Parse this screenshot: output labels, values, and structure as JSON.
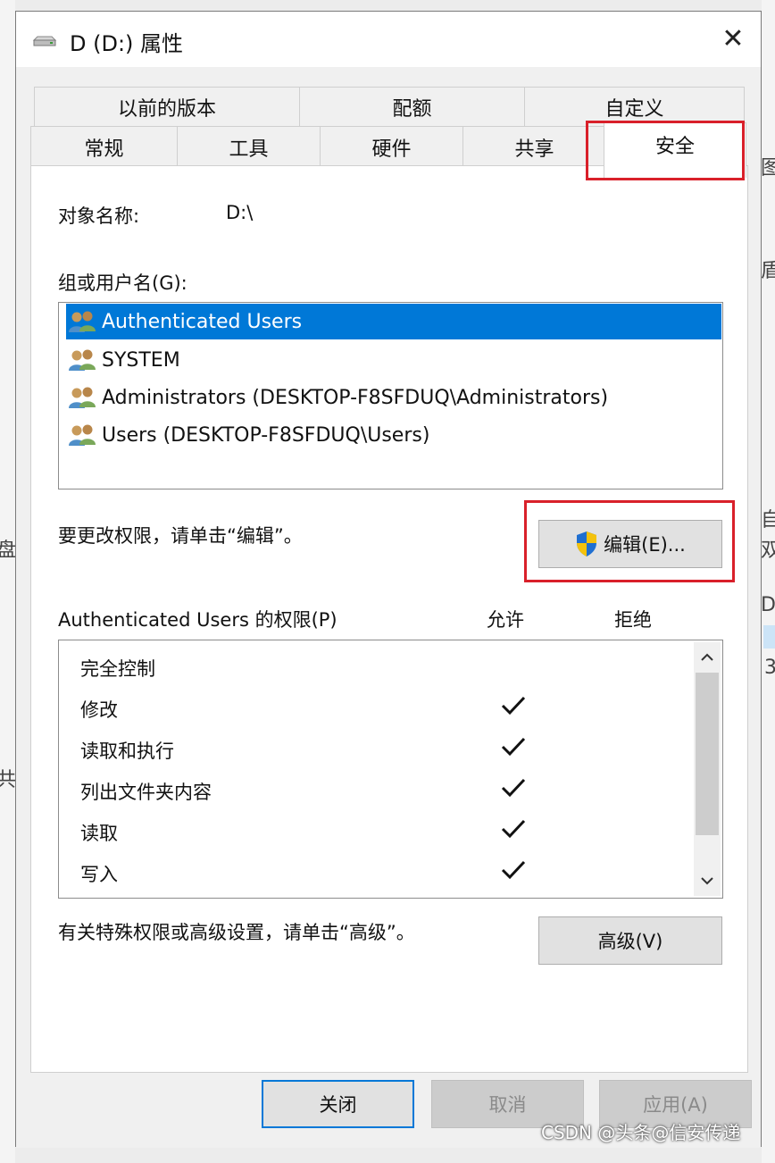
{
  "window": {
    "title": "D (D:) 属性",
    "close_glyph": "✕",
    "drive_icon": "drive-icon"
  },
  "tabs": {
    "row1": [
      "以前的版本",
      "配额",
      "自定义"
    ],
    "row2": [
      "常规",
      "工具",
      "硬件",
      "共享",
      "安全"
    ],
    "active": "安全"
  },
  "security": {
    "object_name_label": "对象名称:",
    "object_name_value": "D:\\",
    "group_label": "组或用户名(G):",
    "users": [
      {
        "name": "Authenticated Users",
        "selected": true
      },
      {
        "name": "SYSTEM",
        "selected": false
      },
      {
        "name": "Administrators (DESKTOP-F8SFDUQ\\Administrators)",
        "selected": false
      },
      {
        "name": "Users (DESKTOP-F8SFDUQ\\Users)",
        "selected": false
      }
    ],
    "change_hint": "要更改权限，请单击“编辑”。",
    "edit_button": "编辑(E)...",
    "perm_label": "Authenticated Users 的权限(P)",
    "allow_header": "允许",
    "deny_header": "拒绝",
    "permissions": [
      {
        "name": "完全控制",
        "allow": false,
        "deny": false
      },
      {
        "name": "修改",
        "allow": true,
        "deny": false
      },
      {
        "name": "读取和执行",
        "allow": true,
        "deny": false
      },
      {
        "name": "列出文件夹内容",
        "allow": true,
        "deny": false
      },
      {
        "name": "读取",
        "allow": true,
        "deny": false
      },
      {
        "name": "写入",
        "allow": true,
        "deny": false
      }
    ],
    "advanced_hint": "有关特殊权限或高级设置，请单击“高级”。",
    "advanced_button": "高级(V)"
  },
  "footer": {
    "close": "关闭",
    "cancel": "取消",
    "apply": "应用(A)"
  },
  "watermark": "CSDN @头条@信安传递",
  "background_glyphs": [
    "图",
    "盾",
    "自",
    "盘",
    "双",
    "D",
    "3",
    "共"
  ],
  "colors": {
    "accent": "#0078d7",
    "highlight_box": "#d9202a",
    "window_bg": "#f0f0f0"
  }
}
